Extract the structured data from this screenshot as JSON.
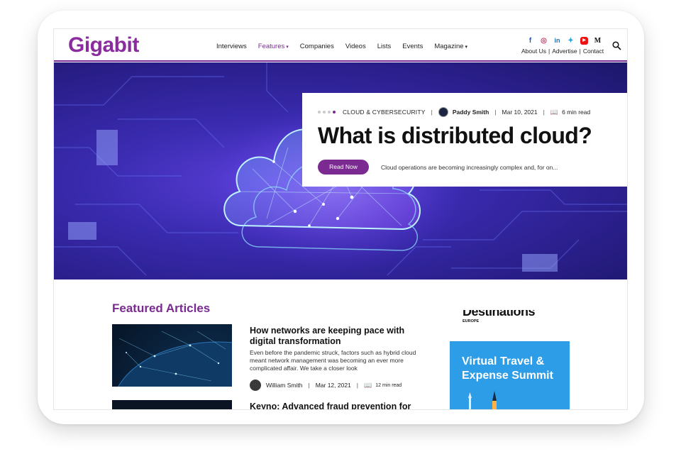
{
  "brand": {
    "logo": "Gigabit",
    "accent": "#7a2a90"
  },
  "nav": [
    {
      "label": "Interviews",
      "dropdown": false,
      "active": false
    },
    {
      "label": "Features",
      "dropdown": true,
      "active": true
    },
    {
      "label": "Companies",
      "dropdown": false,
      "active": false
    },
    {
      "label": "Videos",
      "dropdown": false,
      "active": false
    },
    {
      "label": "Lists",
      "dropdown": false,
      "active": false
    },
    {
      "label": "Events",
      "dropdown": false,
      "active": false
    },
    {
      "label": "Magazine",
      "dropdown": true,
      "active": false
    }
  ],
  "social_icons": [
    "facebook-icon",
    "instagram-icon",
    "linkedin-icon",
    "twitter-icon",
    "youtube-icon",
    "medium-icon"
  ],
  "utility": {
    "about": "About Us",
    "advertise": "Advertise",
    "contact": "Contact",
    "sep": "|"
  },
  "hero": {
    "category": "CLOUD & CYBERSECURITY",
    "author": "Paddy Smith",
    "date": "Mar 10, 2021",
    "read_time": "6 min read",
    "title": "What is distributed cloud?",
    "button": "Read Now",
    "excerpt": "Cloud operations are becoming increasingly complex and, for on..."
  },
  "featured": {
    "heading": "Featured Articles",
    "articles": [
      {
        "title": "How networks are keeping pace with digital transformation",
        "description": "Even before the pandemic struck, factors such as hybrid cloud meant network management was becoming an ever more complicated affair. We take a closer look",
        "author": "William Smith",
        "date": "Mar 12, 2021",
        "read_time": "12 min read"
      },
      {
        "title": "Keyno: Advanced fraud prevention for"
      }
    ]
  },
  "ad": {
    "brand": "Destinations",
    "region": "EUROPE",
    "headline": "Virtual Travel & Expense Summit"
  }
}
